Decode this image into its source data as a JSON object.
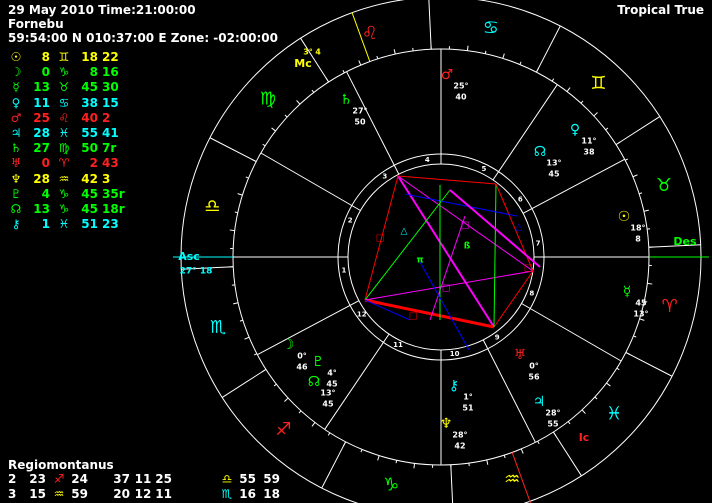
{
  "header": {
    "date_time": "29 May 2010 Time:21:00:00",
    "place": "Fornebu",
    "coords": "59:54:00 N 010:37:00 E Zone: -02:00:00",
    "zodiac_mode": "Tropical True"
  },
  "colors": {
    "background": "#000000",
    "fire": "#ff2020",
    "earth": "#00ff00",
    "air": "#ffff00",
    "water": "#00ffff",
    "text": "#ffffff",
    "aspect_hard": "#ff0000",
    "aspect_square": "#0000ff",
    "aspect_soft": "#00ff00",
    "aspect_minor": "#ff00ff"
  },
  "positions": [
    {
      "planet": "☉",
      "deg": "8",
      "sign": "♊",
      "min": "18",
      "sec": "22",
      "color": "#ffff00",
      "sign_color": "#ffff00"
    },
    {
      "planet": "☽",
      "deg": "0",
      "sign": "♑",
      "min": "8",
      "sec": "16",
      "color": "#00ff00",
      "sign_color": "#00ff00"
    },
    {
      "planet": "☿",
      "deg": "13",
      "sign": "♉",
      "min": "45",
      "sec": "30",
      "color": "#00ff00",
      "sign_color": "#00ff00"
    },
    {
      "planet": "♀",
      "deg": "11",
      "sign": "♋",
      "min": "38",
      "sec": "15",
      "color": "#00ffff",
      "sign_color": "#00ffff"
    },
    {
      "planet": "♂",
      "deg": "25",
      "sign": "♌",
      "min": "40",
      "sec": "2",
      "color": "#ff2020",
      "sign_color": "#ff2020"
    },
    {
      "planet": "♃",
      "deg": "28",
      "sign": "♓",
      "min": "55",
      "sec": "41",
      "color": "#00ffff",
      "sign_color": "#00ffff"
    },
    {
      "planet": "♄",
      "deg": "27",
      "sign": "♍",
      "min": "50",
      "sec": "7r",
      "color": "#00ff00",
      "sign_color": "#00ff00"
    },
    {
      "planet": "♅",
      "deg": "0",
      "sign": "♈",
      "min": "2",
      "sec": "43",
      "color": "#ff2020",
      "sign_color": "#ff2020"
    },
    {
      "planet": "♆",
      "deg": "28",
      "sign": "♒",
      "min": "42",
      "sec": "3",
      "color": "#ffff00",
      "sign_color": "#ffff00"
    },
    {
      "planet": "♇",
      "deg": "4",
      "sign": "♑",
      "min": "45",
      "sec": "35r",
      "color": "#00ff00",
      "sign_color": "#00ff00"
    },
    {
      "planet": "☊",
      "deg": "13",
      "sign": "♑",
      "min": "45",
      "sec": "18r",
      "color": "#00ff00",
      "sign_color": "#00ff00"
    },
    {
      "planet": "⚷",
      "deg": "1",
      "sign": "♓",
      "min": "51",
      "sec": "23",
      "color": "#00ffff",
      "sign_color": "#00ffff"
    }
  ],
  "houses": {
    "system": "Regiomontanus",
    "rows": [
      [
        {
          "num": "2",
          "deg": "23",
          "sign": "♐",
          "min": "24",
          "color": "#ff2020"
        },
        {
          "num": "",
          "deg": "37",
          "sign": "11",
          "min": "25",
          "color": "#ffffff"
        },
        {
          "num": "",
          "deg": "",
          "sign": "♎",
          "min": "55",
          "extra": "59",
          "color": "#ffff00"
        }
      ],
      [
        {
          "num": "3",
          "deg": "15",
          "sign": "♒",
          "min": "59",
          "color": "#ffff00"
        },
        {
          "num": "",
          "deg": "20",
          "sign": "12",
          "min": "11",
          "color": "#ffffff"
        },
        {
          "num": "",
          "deg": "",
          "sign": "♏",
          "min": "16",
          "extra": "18",
          "color": "#00ffff"
        }
      ]
    ]
  },
  "wheel": {
    "mc_label": "Mc",
    "mc_deg": "3°",
    "mc_min": "4",
    "asc_label": "Asc",
    "asc_pos": "27° 18",
    "des_label": "Des",
    "ic_label": "Ic",
    "zodiac_signs": [
      {
        "glyph": "♍",
        "color": "#00ff00"
      },
      {
        "glyph": "♌",
        "color": "#ff2020"
      },
      {
        "glyph": "♋",
        "color": "#00ffff"
      },
      {
        "glyph": "♊",
        "color": "#ffff00"
      },
      {
        "glyph": "♉",
        "color": "#00ff00"
      },
      {
        "glyph": "♈",
        "color": "#ff2020"
      },
      {
        "glyph": "♓",
        "color": "#00ffff"
      },
      {
        "glyph": "♒",
        "color": "#ffff00"
      },
      {
        "glyph": "♑",
        "color": "#00ff00"
      },
      {
        "glyph": "♐",
        "color": "#ff2020"
      },
      {
        "glyph": "♏",
        "color": "#00ffff"
      },
      {
        "glyph": "♎",
        "color": "#ffff00"
      }
    ],
    "house_numbers": [
      "1",
      "2",
      "3",
      "4",
      "5",
      "6",
      "7",
      "8",
      "9",
      "10",
      "11",
      "12"
    ],
    "planet_labels": [
      {
        "glyph": "♂",
        "deg": "25°",
        "min": "40",
        "color": "#ff2020"
      },
      {
        "glyph": "♄",
        "deg": "27°",
        "min": "50",
        "color": "#00ff00"
      },
      {
        "glyph": "♀",
        "deg": "11°",
        "min": "38",
        "color": "#00ffff"
      },
      {
        "glyph": "☊",
        "deg": "13°",
        "min": "45",
        "color": "#00ffff"
      },
      {
        "glyph": "☉",
        "deg": "18°",
        "min": "8",
        "color": "#ffff00"
      },
      {
        "glyph": "☿",
        "deg": "45",
        "min": "13°",
        "color": "#00ff00"
      },
      {
        "glyph": "♅",
        "deg": "0°",
        "min": "56",
        "color": "#ff2020"
      },
      {
        "glyph": "♃",
        "deg": "28°",
        "min": "55",
        "color": "#00ffff"
      },
      {
        "glyph": "⚷",
        "deg": "1°",
        "min": "51",
        "color": "#00ffff"
      },
      {
        "glyph": "♆",
        "deg": "28°",
        "min": "42",
        "color": "#ffff00"
      },
      {
        "glyph": "☽",
        "deg": "0°",
        "min": "46",
        "color": "#00ff00"
      },
      {
        "glyph": "♇",
        "deg": "4°",
        "min": "45",
        "color": "#00ff00"
      },
      {
        "glyph": "☊",
        "deg": "13°",
        "min": "45",
        "color": "#00ff00"
      }
    ]
  }
}
